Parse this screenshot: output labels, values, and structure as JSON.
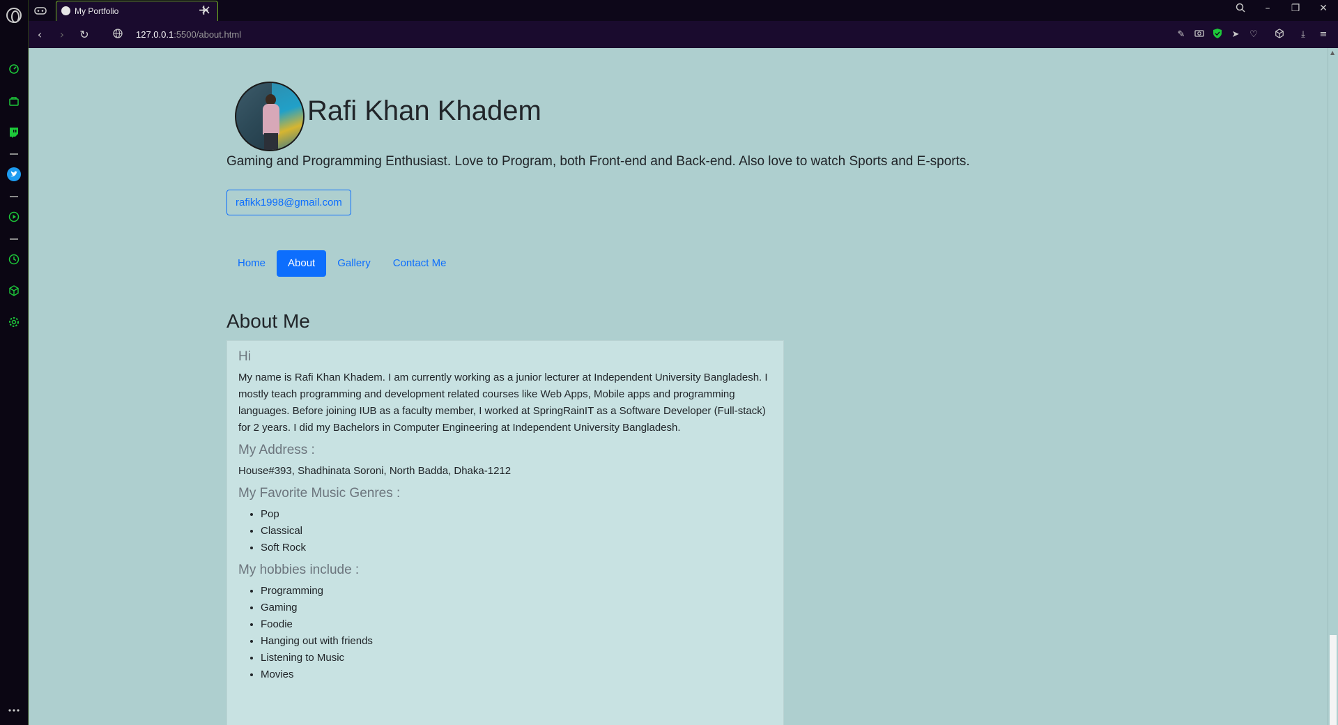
{
  "browser": {
    "tab_title": "My Portfolio",
    "url_host": "127.0.0.1",
    "url_rest": ":5500/about.html"
  },
  "page": {
    "name": "Rafi Khan Khadem",
    "tagline": "Gaming and Programming Enthusiast. Love to Program, both Front-end and Back-end. Also love to watch Sports and E-sports.",
    "email": "rafikk1998@gmail.com",
    "nav": [
      "Home",
      "About",
      "Gallery",
      "Contact Me"
    ],
    "active_nav": "About",
    "section_title": "About Me",
    "card": {
      "greeting": "Hi",
      "bio": "My name is Rafi Khan Khadem. I am currently working as a junior lecturer at Independent University Bangladesh. I mostly teach programming and development related courses like Web Apps, Mobile apps and programming languages. Before joining IUB as a faculty member, I worked at SpringRainIT as a Software Developer (Full-stack) for 2 years. I did my Bachelors in Computer Engineering at Independent University Bangladesh.",
      "address_heading": "My Address :",
      "address": "House#393, Shadhinata Soroni, North Badda, Dhaka-1212",
      "music_heading": "My Favorite Music Genres :",
      "music": [
        "Pop",
        "Classical",
        "Soft Rock"
      ],
      "hobbies_heading": "My hobbies include :",
      "hobbies": [
        "Programming",
        "Gaming",
        "Foodie",
        "Hanging out with friends",
        "Listening to Music",
        "Movies"
      ]
    }
  },
  "colors": {
    "page_bg": "#aecfcf",
    "card_bg": "#c8e2e2",
    "primary": "#0d6efd",
    "browser_frame": "#1a0b2e",
    "accent_border": "#6fb21e"
  },
  "icons": {
    "sidebar": [
      "speed-dial-icon",
      "shopping-bag-icon",
      "twitch-icon",
      "twitter-icon",
      "player-icon",
      "history-icon",
      "extensions-icon",
      "settings-icon",
      "more-icon"
    ],
    "toolbar": [
      "edit-icon",
      "camera-icon",
      "shield-icon",
      "send-icon",
      "heart-icon",
      "box-icon",
      "download-icon",
      "menu-icon"
    ]
  }
}
